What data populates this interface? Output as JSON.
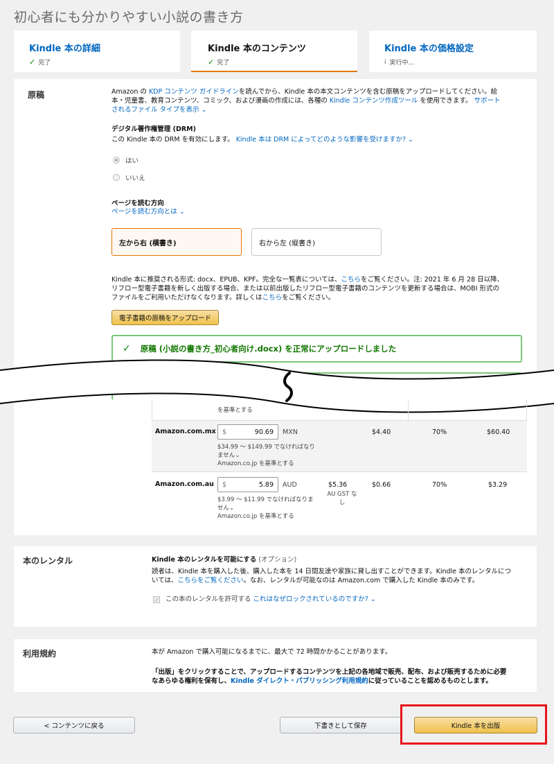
{
  "page_title": "初心者にも分かりやすい小説の書き方",
  "tabs": [
    {
      "label": "Kindle 本の詳細",
      "status": "完了"
    },
    {
      "label": "Kindle 本のコンテンツ",
      "status": "完了"
    },
    {
      "label": "Kindle 本の価格設定",
      "status": "実行中..."
    }
  ],
  "manuscript": {
    "heading": "原稿",
    "intro_1": "Amazon の",
    "intro_link1": "KDP コンテンツ ガイドライン",
    "intro_2": "を読んでから、Kindle 本の本文コンテンツを含む原稿をアップロードしてください。絵",
    "intro_3": "本・児童書、教育コンテンツ、コミック、および漫画の作成には、各種の",
    "intro_link2": "Kindle コンテンツ作成ツール",
    "intro_4": "を使用できます。",
    "intro_link3a": "サポート",
    "intro_link3b": "されるファイル タイプを表示",
    "drm_heading": "デジタル著作権管理 (DRM)",
    "drm_text": "この Kindle 本の DRM を有効にします。",
    "drm_link": "Kindle 本は DRM によってどのような影響を受けますか?",
    "radio_yes": "はい",
    "radio_no": "いいえ",
    "dir_heading": "ページを読む方向",
    "dir_link": "ページを読む方向とは",
    "dir_ltr": "左から右 (横書き)",
    "dir_rtl": "右から左 (縦書き)",
    "formats_1": "Kindle 本に推奨される形式: docx、EPUB、KPF。完全な一覧表については、",
    "formats_link1": "こちら",
    "formats_2": "をご覧ください。注: 2021 年 6 月 28 日以降、",
    "formats_3": "リフロー型電子書籍を新しく出版する場合、または以前出版したリフロー型電子書籍のコンテンツを更新する場合は、MOBI 形式の",
    "formats_4": "ファイルをご利用いただけなくなります。詳しくは",
    "formats_link2": "こちら",
    "formats_5": "をご覧ください。",
    "upload_button": "電子書籍の原稿をアップロード",
    "success_msg": "原稿 (小説の書き方_初心者向け.docx) を正常にアップロードしました"
  },
  "pricing_rows": [
    {
      "cut_note": "を基準とする"
    },
    {
      "market": "Amazon.com.mx",
      "currency_symbol": "$",
      "price": "90.69",
      "currency": "MXN",
      "tax": "",
      "delivery": "$4.40",
      "royalty_rate": "70%",
      "royalty": "$60.40",
      "range_1": "$34.99 ～ $149.99 でなければなり",
      "range_2": "ません",
      "basis": "Amazon.co.jp を基準とする"
    },
    {
      "market": "Amazon.com.au",
      "currency_symbol": "$",
      "price": "5.89",
      "currency": "AUD",
      "tax": "$5.36",
      "tax_note_1": "AU GST な",
      "tax_note_2": "し",
      "delivery": "$0.66",
      "royalty_rate": "70%",
      "royalty": "$3.29",
      "range_1": "$3.99 ～ $11.99 でなければなりま",
      "range_2": "せん",
      "basis": "Amazon.co.jp を基準とする"
    }
  ],
  "rental": {
    "heading": "本のレンタル",
    "title": "Kindle 本のレンタルを可能にする",
    "optional": "(オプション)",
    "desc_1": "読者は、Kindle 本を購入した後、購入した本を 14 日間友達や家族に貸し出すことができます。Kindle 本のレンタルにつ",
    "desc_2a": "いては、",
    "desc_link": "こちらをご覧ください",
    "desc_2b": "。なお、レンタルが可能なのは Amazon.com で購入した Kindle 本のみです。",
    "checkbox_label": "この本のレンタルを許可する",
    "lock_link": "これはなぜロックされているのですか?"
  },
  "terms": {
    "heading": "利用規約",
    "line1": "本が Amazon で購入可能になるまでに、最大で 72 時間かかることがあります。",
    "bold_1": "「出版」をクリックすることで、アップロードするコンテンツを上記の各地域で販売、配布、および販売するために必要",
    "bold_2a": "なあらゆる権利を保有し、",
    "bold_link": "Kindle ダイレクト・パブリッシング利用規約",
    "bold_2b": "に従っていることを認めるものとします。"
  },
  "footer": {
    "back": "< コンテンツに戻る",
    "save_draft": "下書きとして保存",
    "publish": "Kindle 本を出版"
  }
}
